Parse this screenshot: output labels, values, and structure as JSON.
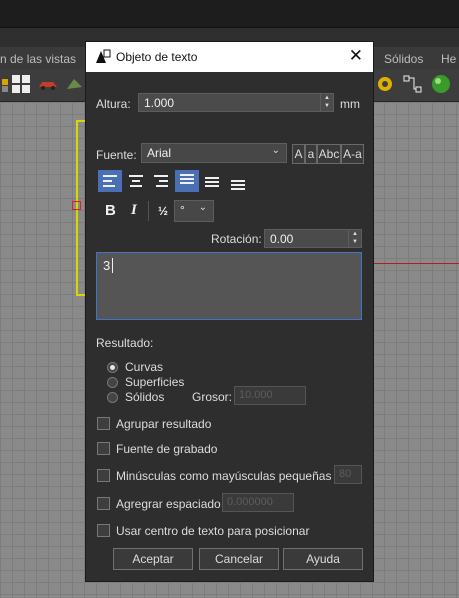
{
  "background_app": {
    "tabs": [
      "n de las vistas",
      "Sólidos",
      "He"
    ]
  },
  "dialog": {
    "title": "Objeto de texto",
    "altura": {
      "label": "Altura:",
      "value": "1.000",
      "unit": "mm"
    },
    "fuente": {
      "label": "Fuente:",
      "value": "Arial",
      "case_buttons": [
        "A",
        "a",
        "Abc",
        "A-a"
      ]
    },
    "alignment_selected": [
      "left",
      "justify-top"
    ],
    "format": {
      "bold": "B",
      "italic": "I",
      "fraction": "½",
      "symbol": "°"
    },
    "rotacion": {
      "label": "Rotación:",
      "value": "0.00"
    },
    "text_content": "3",
    "resultado": {
      "label": "Resultado:",
      "options": [
        "Curvas",
        "Superficies",
        "Sólidos"
      ],
      "selected": "Curvas",
      "grosor_label": "Grosor:",
      "grosor_value": "10.000"
    },
    "checkboxes": {
      "agrupar": "Agrupar resultado",
      "grabado": "Fuente de grabado",
      "minusculas": "Minúsculas como mayúsculas pequeñas",
      "minusculas_value": "80",
      "espaciado": "Agregrar espaciado",
      "espaciado_value": "0.000000",
      "centro": "Usar centro de texto para posicionar"
    },
    "buttons": {
      "ok": "Aceptar",
      "cancel": "Cancelar",
      "help": "Ayuda"
    }
  }
}
